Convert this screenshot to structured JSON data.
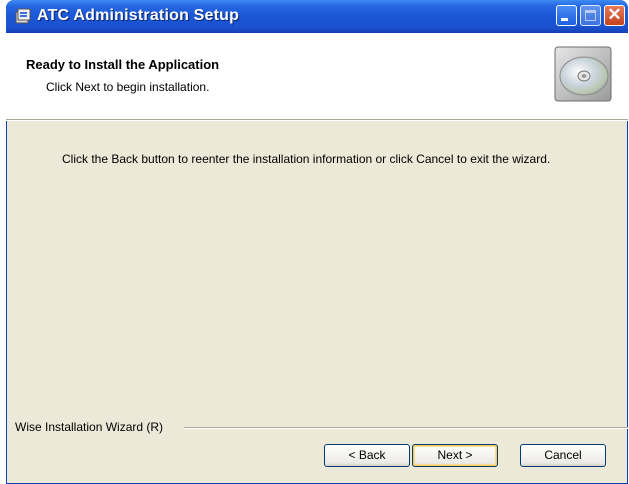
{
  "window": {
    "title": "ATC Administration Setup",
    "titlebar_color": "#1b56d6"
  },
  "header": {
    "title": "Ready to Install the Application",
    "subtitle": "Click Next to begin installation."
  },
  "body": {
    "message": "Click the Back button to reenter the installation information or click Cancel to exit the wizard."
  },
  "footer": {
    "brand_label": "Wise Installation Wizard (R)",
    "back_label": "< Back",
    "next_label": "Next >",
    "cancel_label": "Cancel"
  },
  "icons": {
    "app": "installer-icon",
    "header": "cd-disc-icon"
  }
}
